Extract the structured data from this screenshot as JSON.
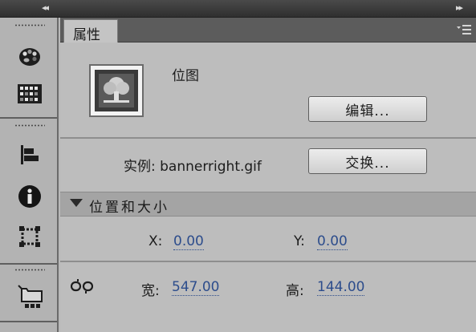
{
  "topbar": {
    "left_arrows": "◂◂",
    "right_arrows": "▸▸"
  },
  "tools": [
    {
      "icon": "palette-icon"
    },
    {
      "icon": "color-swatches-icon"
    },
    {
      "icon": "align-icon"
    },
    {
      "icon": "info-icon"
    },
    {
      "icon": "transform-icon"
    },
    {
      "icon": "library-icon"
    }
  ],
  "panel": {
    "tab_label": "属性",
    "menu_icon": "panel-menu-icon",
    "symbol_type": "位图",
    "edit_button": "编辑...",
    "instance_label": "实例: bannerright.gif",
    "swap_button": "交换...",
    "section_title": "位置和大小",
    "x_label": "X:",
    "x_value": "0.00",
    "y_label": "Y:",
    "y_value": "0.00",
    "width_label": "宽:",
    "width_value": "547.00",
    "height_label": "高:",
    "height_value": "144.00"
  },
  "colors": {
    "accent_value": "#2d4d8c",
    "panel_bg": "#bdbdbd",
    "tab_strip": "#5c5c5c"
  }
}
